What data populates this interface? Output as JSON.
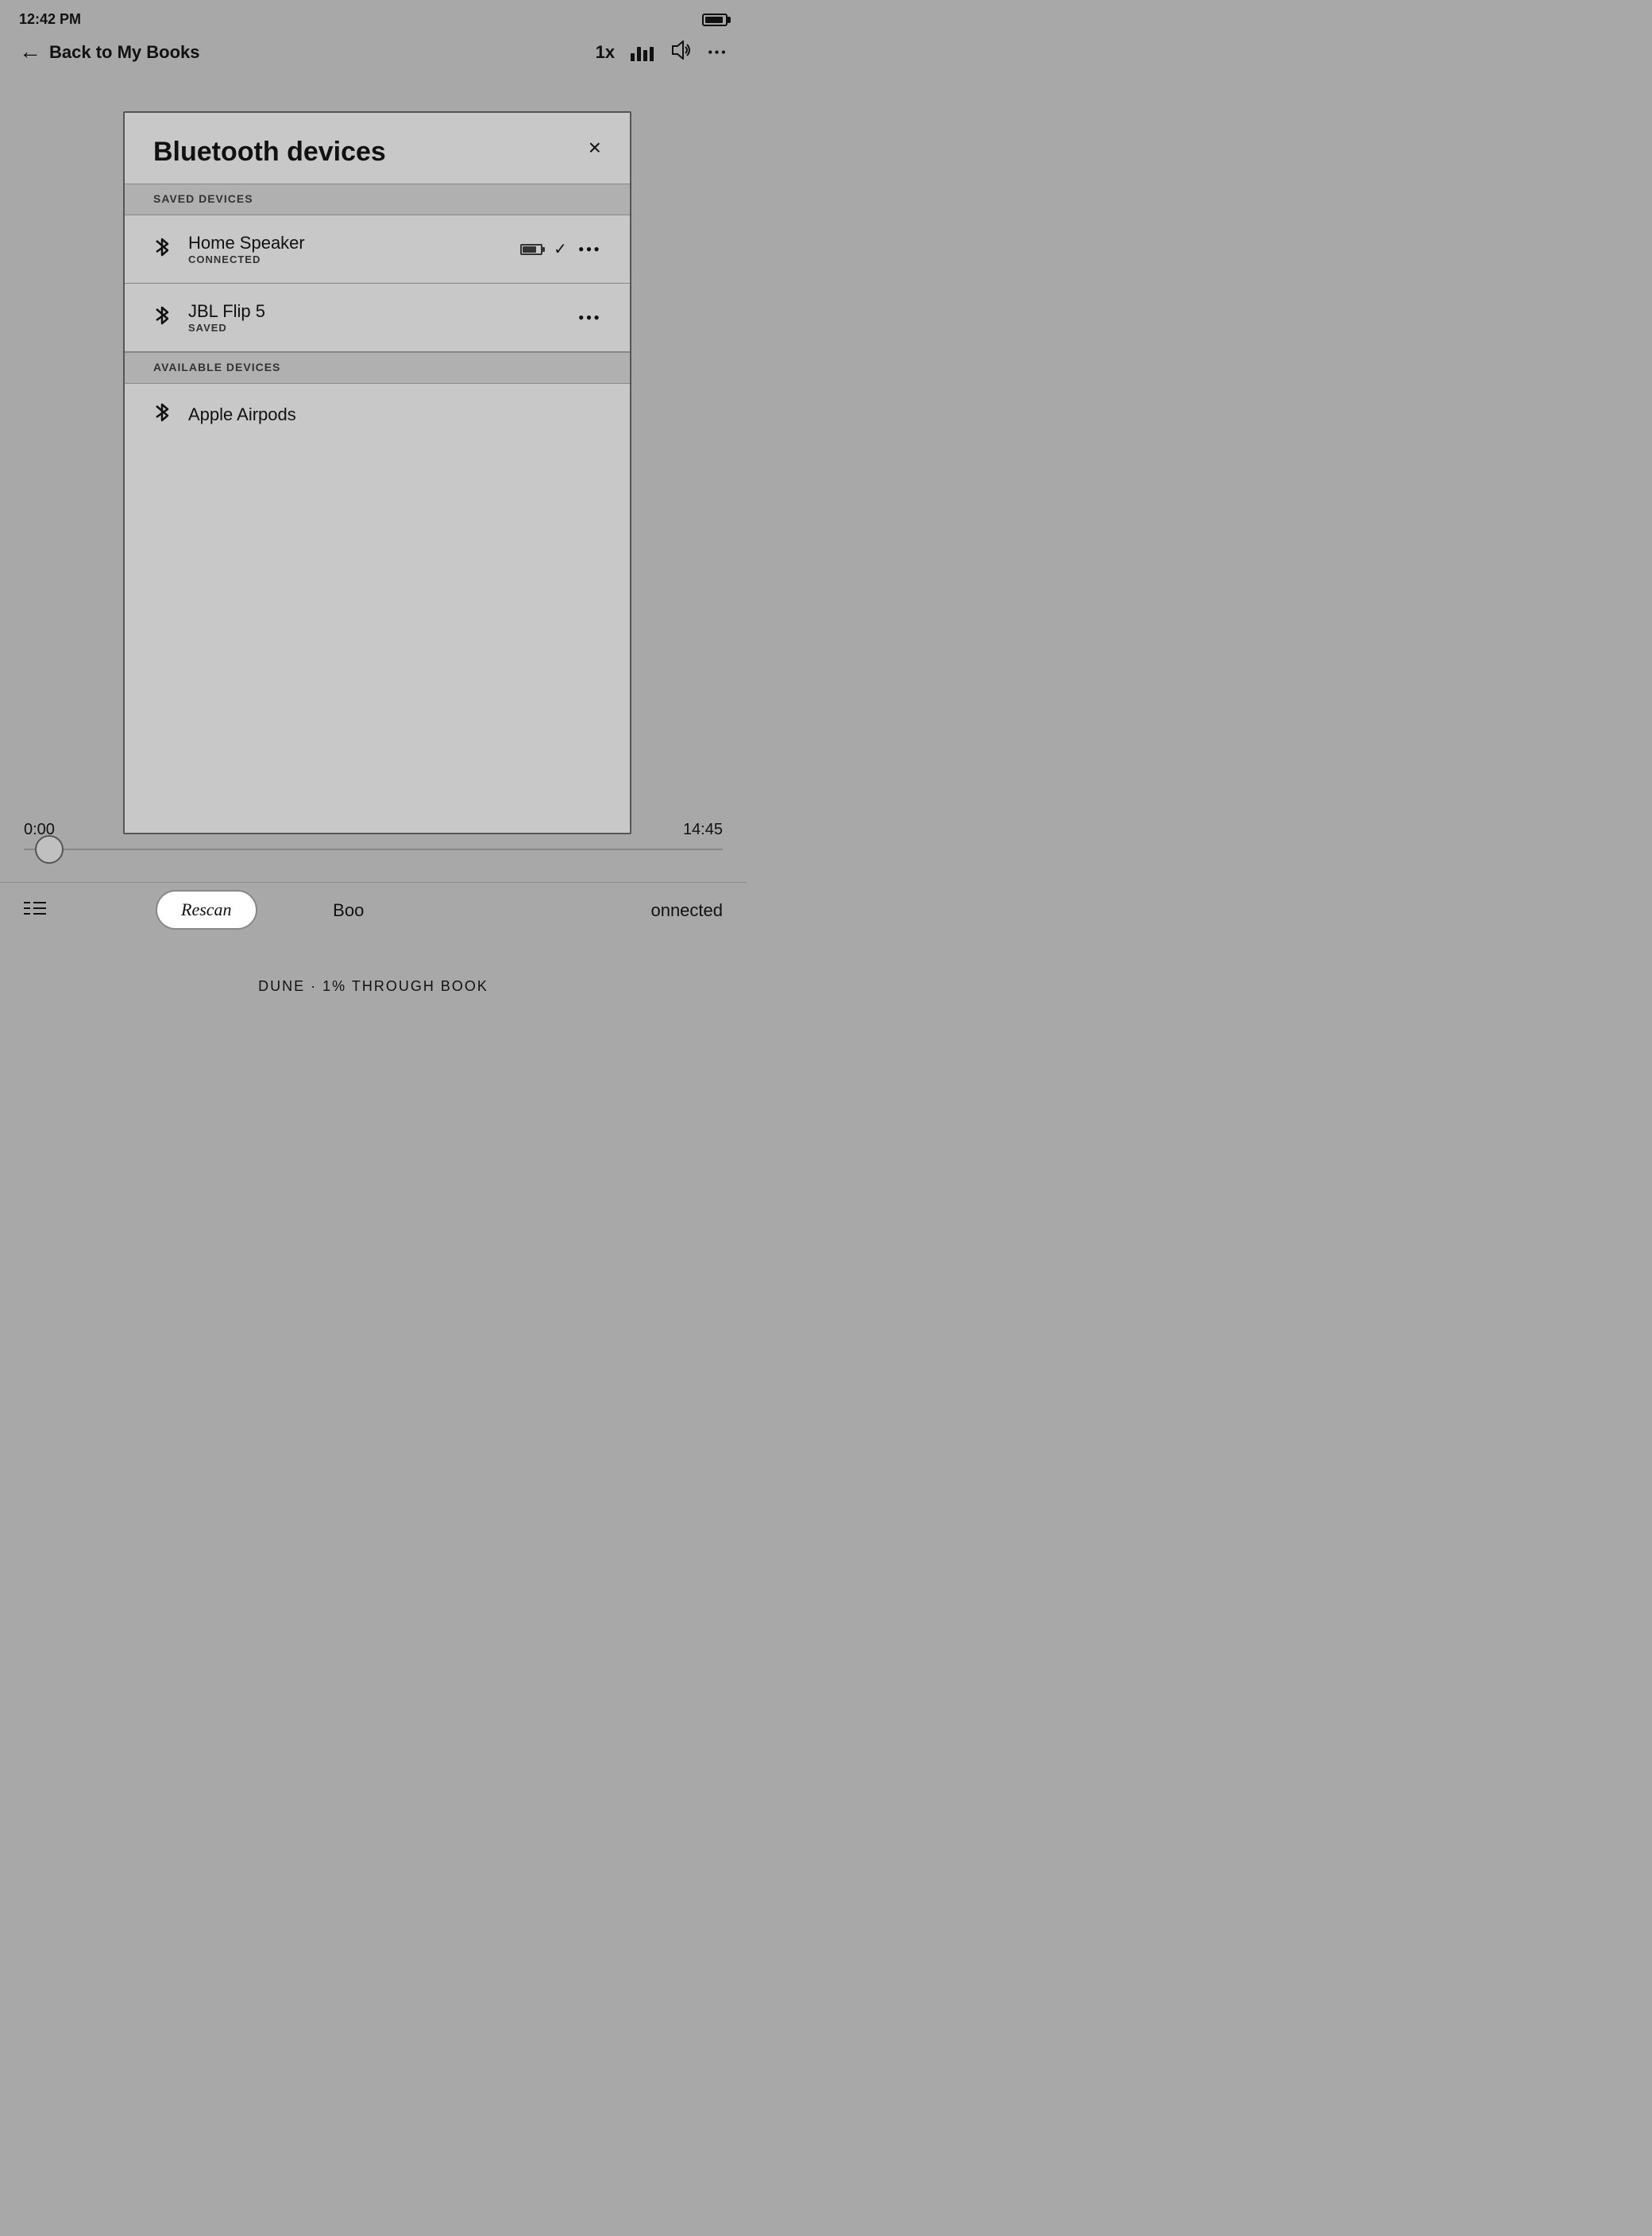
{
  "statusBar": {
    "time": "12:42 PM"
  },
  "navBar": {
    "backLabel": "Back to My Books",
    "speed": "1x",
    "moreLabel": "•••"
  },
  "modal": {
    "title": "Bluetooth devices",
    "closeLabel": "×",
    "savedSection": "SAVED DEVICES",
    "availableSection": "AVAILABLE DEVICES",
    "savedDevices": [
      {
        "name": "Home Speaker",
        "status": "CONNECTED",
        "hasBattery": true,
        "hasCheck": true,
        "hasMore": true
      },
      {
        "name": "JBL Flip 5",
        "status": "SAVED",
        "hasBattery": false,
        "hasCheck": false,
        "hasMore": true
      }
    ],
    "availableDevices": [
      {
        "name": "Apple Airpods",
        "status": "",
        "hasBattery": false,
        "hasCheck": false,
        "hasMore": false
      }
    ]
  },
  "progress": {
    "currentTime": "0:00",
    "totalTime": "14:45"
  },
  "bottomBar": {
    "bookLabel": "Boo",
    "connectedLabel": "onnected"
  },
  "rescanButton": "Rescan",
  "bookInfo": "DUNE · 1% THROUGH BOOK"
}
